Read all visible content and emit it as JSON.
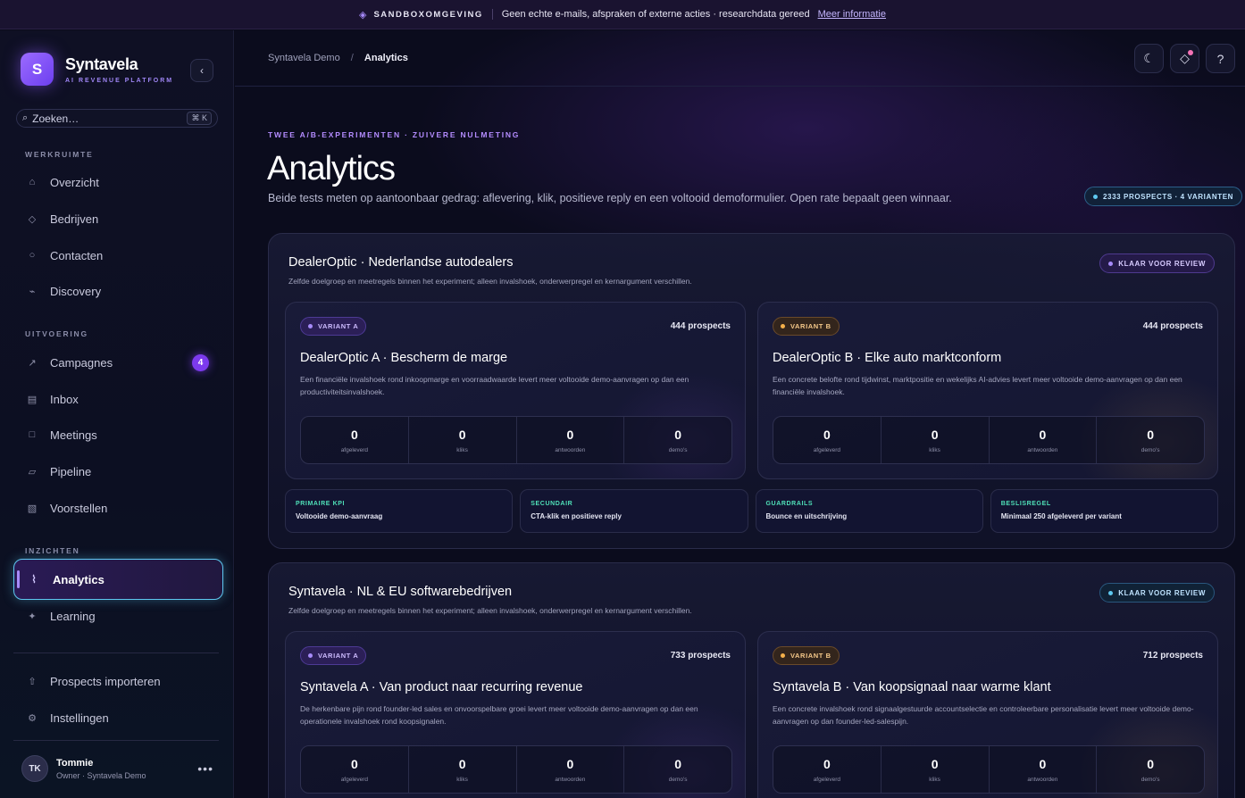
{
  "banner": {
    "tag": "SANDBOXOMGEVING",
    "text": "Geen echte e-mails, afspraken of externe acties · researchdata gereed",
    "link": "Meer informatie"
  },
  "brand": {
    "name": "Syntavela",
    "subtitle": "AI REVENUE PLATFORM",
    "logo_letter": "S"
  },
  "search": {
    "placeholder": "Zoeken…",
    "shortcut": "⌘ K"
  },
  "sidebar": {
    "sections": [
      {
        "label": "WERKRUIMTE"
      },
      {
        "label": "UITVOERING"
      },
      {
        "label": "INZICHTEN"
      }
    ],
    "items": [
      {
        "label": "Overzicht",
        "icon": "home-icon",
        "glyph": "⌂"
      },
      {
        "label": "Bedrijven",
        "icon": "diamond-icon",
        "glyph": "◇"
      },
      {
        "label": "Contacten",
        "icon": "circle-icon",
        "glyph": "○"
      },
      {
        "label": "Discovery",
        "icon": "signal-icon",
        "glyph": "⌁"
      },
      {
        "label": "Campagnes",
        "icon": "arrow-up-right-icon",
        "glyph": "↗",
        "badge": "4"
      },
      {
        "label": "Inbox",
        "icon": "inbox-icon",
        "glyph": "▤"
      },
      {
        "label": "Meetings",
        "icon": "calendar-icon",
        "glyph": "□"
      },
      {
        "label": "Pipeline",
        "icon": "pipeline-icon",
        "glyph": "▱"
      },
      {
        "label": "Voorstellen",
        "icon": "document-icon",
        "glyph": "▧"
      },
      {
        "label": "Analytics",
        "icon": "analytics-icon",
        "glyph": "⌇",
        "active": true
      },
      {
        "label": "Learning",
        "icon": "sparkle-icon",
        "glyph": "✦"
      }
    ],
    "footer_items": [
      {
        "label": "Prospects importeren",
        "icon": "upload-icon",
        "glyph": "⇧"
      },
      {
        "label": "Instellingen",
        "icon": "gear-icon",
        "glyph": "⚙"
      }
    ],
    "user": {
      "initials": "TK",
      "name": "Tommie",
      "role": "Owner · Syntavela Demo"
    }
  },
  "breadcrumb": {
    "parent": "Syntavela Demo",
    "current": "Analytics"
  },
  "header": {
    "eyebrow": "TWEE A/B-EXPERIMENTEN · ZUIVERE NULMETING",
    "title": "Analytics",
    "subtitle": "Beide tests meten op aantoonbaar gedrag: aflevering, klik, positieve reply en een voltooid demoformulier. Open rate bepaalt geen winnaar.",
    "count_pill": "2333 PROSPECTS · 4 VARIANTEN"
  },
  "metric_labels": [
    "afgeleverd",
    "kliks",
    "antwoorden",
    "demo's"
  ],
  "experiments": [
    {
      "title": "DealerOptic · Nederlandse autodealers",
      "description": "Zelfde doelgroep en meetregels binnen het experiment; alleen invalshoek, onderwerpregel en kernargument verschillen.",
      "status": "KLAAR VOOR REVIEW",
      "status_color": "#a78bfa",
      "variants": [
        {
          "badge": "VARIANT A",
          "prospects": "444 prospects",
          "title": "DealerOptic A · Bescherm de marge",
          "description": "Een financiële invalshoek rond inkoopmarge en voorraadwaarde levert meer voltooide demo-aanvragen op dan een productiviteitsinvalshoek.",
          "metrics": [
            "0",
            "0",
            "0",
            "0"
          ]
        },
        {
          "badge": "VARIANT B",
          "prospects": "444 prospects",
          "title": "DealerOptic B · Elke auto marktconform",
          "description": "Een concrete belofte rond tijdwinst, marktpositie en wekelijks AI-advies levert meer voltooide demo-aanvragen op dan een financiële invalshoek.",
          "metrics": [
            "0",
            "0",
            "0",
            "0"
          ]
        }
      ],
      "kpis": [
        {
          "label": "PRIMAIRE KPI",
          "value": "Voltooide demo-aanvraag"
        },
        {
          "label": "SECUNDAIR",
          "value": "CTA-klik en positieve reply"
        },
        {
          "label": "GUARDRAILS",
          "value": "Bounce en uitschrijving"
        },
        {
          "label": "BESLISREGEL",
          "value": "Minimaal 250 afgeleverd per variant"
        }
      ]
    },
    {
      "title": "Syntavela · NL & EU softwarebedrijven",
      "description": "Zelfde doelgroep en meetregels binnen het experiment; alleen invalshoek, onderwerpregel en kernargument verschillen.",
      "status": "KLAAR VOOR REVIEW",
      "status_color": "#5ec8f0",
      "variants": [
        {
          "badge": "VARIANT A",
          "prospects": "733 prospects",
          "title": "Syntavela A · Van product naar recurring revenue",
          "description": "De herkenbare pijn rond founder-led sales en onvoorspelbare groei levert meer voltooide demo-aanvragen op dan een operationele invalshoek rond koopsignalen.",
          "metrics": [
            "0",
            "0",
            "0",
            "0"
          ]
        },
        {
          "badge": "VARIANT B",
          "prospects": "712 prospects",
          "title": "Syntavela B · Van koopsignaal naar warme klant",
          "description": "Een concrete invalshoek rond signaalgestuurde accountselectie en controleerbare personalisatie levert meer voltooide demo-aanvragen op dan founder-led-salespijn.",
          "metrics": [
            "0",
            "0",
            "0",
            "0"
          ]
        }
      ]
    }
  ],
  "topbar_buttons": [
    {
      "icon": "moon-icon",
      "glyph": "☾"
    },
    {
      "icon": "notification-icon",
      "glyph": "◇"
    },
    {
      "icon": "help-icon",
      "glyph": "?"
    }
  ]
}
